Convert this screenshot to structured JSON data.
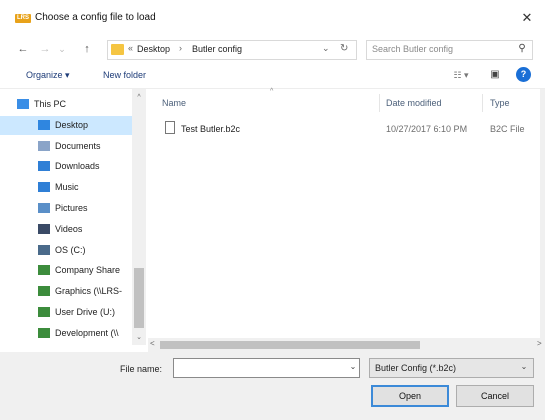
{
  "window": {
    "title": "Choose a config file to load",
    "app_icon_text": "LRS",
    "close_glyph": "✕"
  },
  "nav": {
    "back_glyph": "←",
    "forward_glyph": "→",
    "dropdown_glyph": "⌄",
    "up_glyph": "↑",
    "address_overflow": "«",
    "breadcrumb": [
      "Desktop",
      "Butler config"
    ],
    "address_dropdown_glyph": "⌄",
    "refresh_glyph": "↻",
    "search_placeholder": "Search Butler config",
    "search_glyph": "⚲"
  },
  "toolbar": {
    "organize_label": "Organize ▾",
    "new_folder_label": "New folder",
    "view_glyph": "☷ ▾",
    "pane_glyph": "▣",
    "help_glyph": "?"
  },
  "sidebar": {
    "items": [
      {
        "label": "This PC",
        "icon": "computer-icon",
        "color": "#3a8ee6"
      },
      {
        "label": "Desktop",
        "icon": "desktop-icon",
        "color": "#2f86e0"
      },
      {
        "label": "Documents",
        "icon": "documents-icon",
        "color": "#8aa4c8"
      },
      {
        "label": "Downloads",
        "icon": "downloads-icon",
        "color": "#2f7fd6"
      },
      {
        "label": "Music",
        "icon": "music-icon",
        "color": "#2f7fd6"
      },
      {
        "label": "Pictures",
        "icon": "pictures-icon",
        "color": "#5a8fc8"
      },
      {
        "label": "Videos",
        "icon": "videos-icon",
        "color": "#3a4a66"
      },
      {
        "label": "OS (C:)",
        "icon": "drive-icon",
        "color": "#4a6a8a"
      },
      {
        "label": "Company Share",
        "icon": "network-drive-icon",
        "color": "#3c8c3c"
      },
      {
        "label": "Graphics (\\\\LRS-",
        "icon": "network-drive-icon",
        "color": "#3c8c3c"
      },
      {
        "label": "User Drive (U:)",
        "icon": "network-drive-icon",
        "color": "#3c8c3c"
      },
      {
        "label": "Development (\\\\",
        "icon": "network-drive-icon",
        "color": "#3c8c3c"
      }
    ],
    "selected_index": 1,
    "scroll_up_glyph": "^",
    "scroll_down_glyph": "⌄"
  },
  "file_list": {
    "columns": [
      "Name",
      "Date modified",
      "Type"
    ],
    "sort_glyph": "^",
    "rows": [
      {
        "name": "Test Butler.b2c",
        "date_modified": "10/27/2017 6:10 PM",
        "type": "B2C File"
      }
    ],
    "hscroll_left_glyph": "<",
    "hscroll_right_glyph": ">"
  },
  "footer": {
    "file_name_label": "File name:",
    "file_name_value": "",
    "file_name_drop_glyph": "⌄",
    "file_type_value": "Butler Config (*.b2c)",
    "file_type_drop_glyph": "⌄",
    "open_label": "Open",
    "cancel_label": "Cancel"
  },
  "colors": {
    "accent": "#3c8ad8",
    "selected_bg": "#cce8ff",
    "link": "#1e3c78",
    "help": "#1a6fd6"
  }
}
